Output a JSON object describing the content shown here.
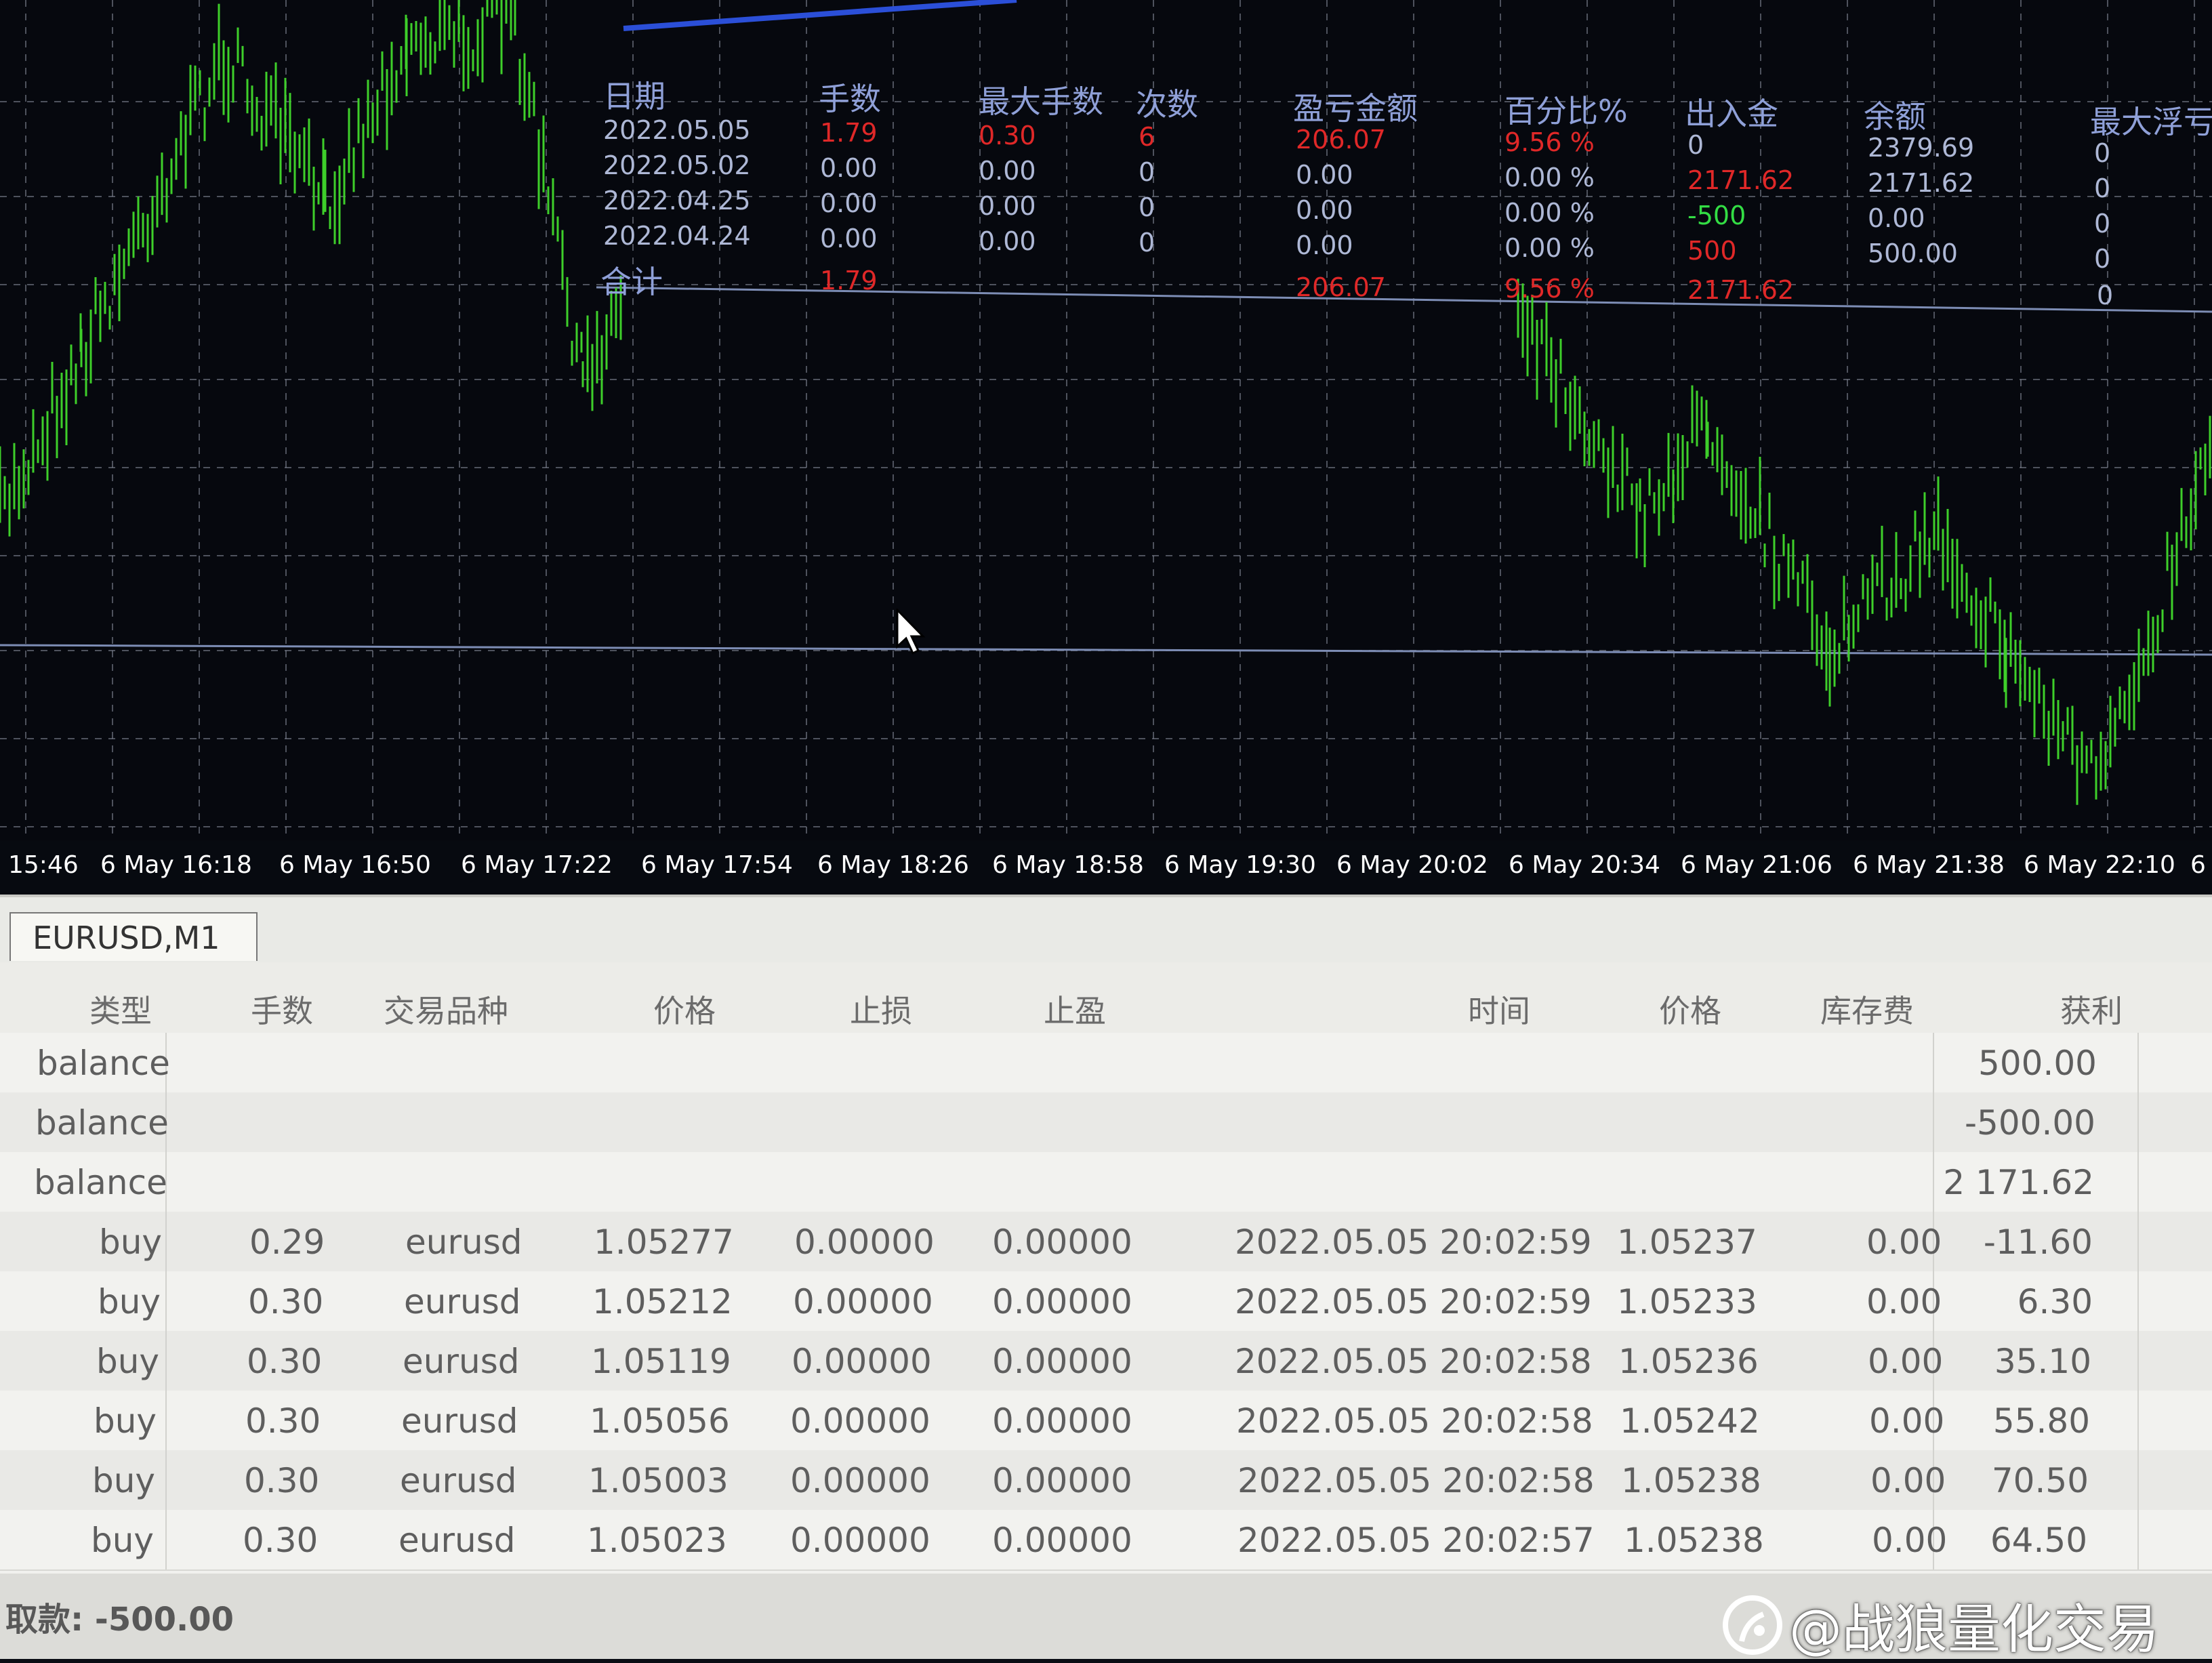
{
  "chart": {
    "time_labels": [
      "15:46",
      "6 May 16:18",
      "6 May 16:50",
      "6 May 17:22",
      "6 May 17:54",
      "6 May 18:26",
      "6 May 18:58",
      "6 May 19:30",
      "6 May 20:02",
      "6 May 20:34",
      "6 May 21:06",
      "6 May 21:38",
      "6 May 22:10",
      "6"
    ],
    "colors": {
      "candle": "#3ecf2a",
      "grid": "#8a8f9e",
      "bg": "#06080e",
      "indicator": "#2b4fd8",
      "hline": "#7d8db5"
    }
  },
  "stats": {
    "headers": {
      "date": "日期",
      "lots": "手数",
      "max_lots": "最大手数",
      "count": "次数",
      "pnl": "盈亏金额",
      "percent": "百分比%",
      "deposit": "出入金",
      "balance": "余额",
      "max_float": "最大浮亏"
    },
    "rows": [
      {
        "date": "2022.05.05",
        "lots": "1.79",
        "max_lots": "0.30",
        "count": "6",
        "pnl": "206.07",
        "percent": "9.56 %",
        "deposit": "0",
        "balance": "2379.69",
        "max_float": "0"
      },
      {
        "date": "2022.05.02",
        "lots": "0.00",
        "max_lots": "0.00",
        "count": "0",
        "pnl": "0.00",
        "percent": "0.00 %",
        "deposit": "2171.62",
        "balance": "2171.62",
        "max_float": "0"
      },
      {
        "date": "2022.04.25",
        "lots": "0.00",
        "max_lots": "0.00",
        "count": "0",
        "pnl": "0.00",
        "percent": "0.00 %",
        "deposit": "-500",
        "balance": "0.00",
        "max_float": "0"
      },
      {
        "date": "2022.04.24",
        "lots": "0.00",
        "max_lots": "0.00",
        "count": "0",
        "pnl": "0.00",
        "percent": "0.00 %",
        "deposit": "500",
        "balance": "500.00",
        "max_float": "0"
      }
    ],
    "total": {
      "label": "合计",
      "lots": "1.79",
      "pnl": "206.07",
      "percent": "9.56 %",
      "deposit": "2171.62",
      "max_float": "0"
    }
  },
  "tab": {
    "label": "EURUSD,M1"
  },
  "table": {
    "headers": {
      "type": "类型",
      "lots": "手数",
      "symbol": "交易品种",
      "price": "价格",
      "sl": "止损",
      "tp": "止盈",
      "time": "时间",
      "price2": "价格",
      "swap": "库存费",
      "profit": "获利"
    },
    "balance_rows": [
      {
        "type": "balance",
        "profit": "500.00"
      },
      {
        "type": "balance",
        "profit": "-500.00"
      },
      {
        "type": "balance",
        "profit": "2 171.62"
      }
    ],
    "trade_rows": [
      {
        "type": "buy",
        "lots": "0.29",
        "symbol": "eurusd",
        "price": "1.05277",
        "sl": "0.00000",
        "tp": "0.00000",
        "time": "2022.05.05 20:02:59",
        "price2": "1.05237",
        "swap": "0.00",
        "profit": "-11.60"
      },
      {
        "type": "buy",
        "lots": "0.30",
        "symbol": "eurusd",
        "price": "1.05212",
        "sl": "0.00000",
        "tp": "0.00000",
        "time": "2022.05.05 20:02:59",
        "price2": "1.05233",
        "swap": "0.00",
        "profit": "6.30"
      },
      {
        "type": "buy",
        "lots": "0.30",
        "symbol": "eurusd",
        "price": "1.05119",
        "sl": "0.00000",
        "tp": "0.00000",
        "time": "2022.05.05 20:02:58",
        "price2": "1.05236",
        "swap": "0.00",
        "profit": "35.10"
      },
      {
        "type": "buy",
        "lots": "0.30",
        "symbol": "eurusd",
        "price": "1.05056",
        "sl": "0.00000",
        "tp": "0.00000",
        "time": "2022.05.05 20:02:58",
        "price2": "1.05242",
        "swap": "0.00",
        "profit": "55.80"
      },
      {
        "type": "buy",
        "lots": "0.30",
        "symbol": "eurusd",
        "price": "1.05003",
        "sl": "0.00000",
        "tp": "0.00000",
        "time": "2022.05.05 20:02:58",
        "price2": "1.05238",
        "swap": "0.00",
        "profit": "70.50"
      },
      {
        "type": "buy",
        "lots": "0.30",
        "symbol": "eurusd",
        "price": "1.05023",
        "sl": "0.00000",
        "tp": "0.00000",
        "time": "2022.05.05 20:02:57",
        "price2": "1.05238",
        "swap": "0.00",
        "profit": "64.50"
      }
    ]
  },
  "status": {
    "withdraw": "取款: -500.00"
  },
  "watermark": {
    "text": "@战狼量化交易",
    "icon": "weibo-style-logo-icon"
  }
}
